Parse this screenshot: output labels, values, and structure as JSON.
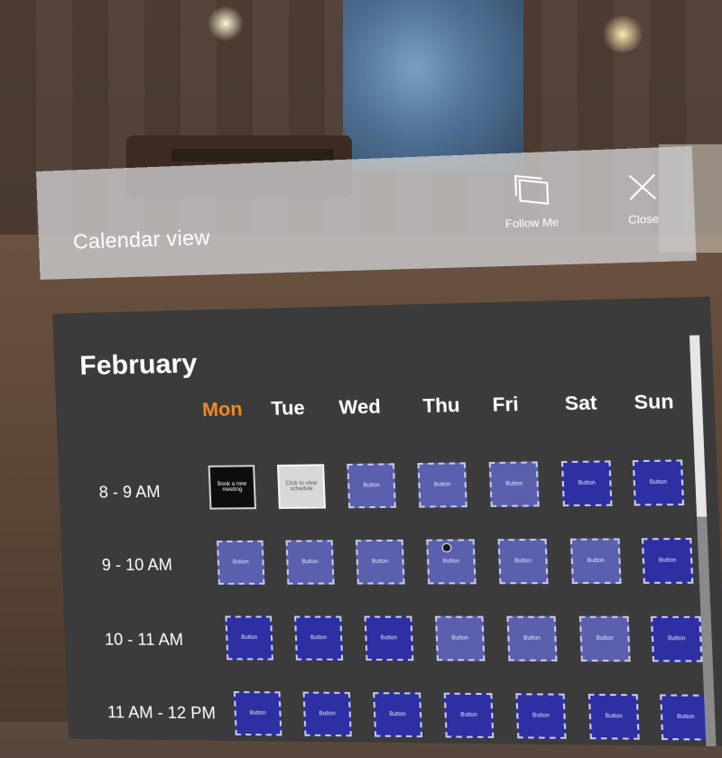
{
  "window": {
    "title": "Calendar view",
    "follow_label": "Follow Me",
    "close_label": "Close"
  },
  "calendar": {
    "month": "February",
    "days": [
      "Mon",
      "Tue",
      "Wed",
      "Thu",
      "Fri",
      "Sat",
      "Sun"
    ],
    "highlighted_day": "Mon",
    "time_slots": [
      "8 - 9 AM",
      "9 - 10 AM",
      "10 - 11 AM",
      "11 AM - 12 PM"
    ],
    "cell_label": "Button",
    "mon_8am_label": "Book a new meeting",
    "tue_8am_label": "Click to view schedule"
  },
  "colors": {
    "accent_today": "#f38b1e",
    "slot_blue": "#2d2fa3",
    "slot_blue_light": "#5a5fae",
    "panel_dark": "#3b3b3c"
  }
}
